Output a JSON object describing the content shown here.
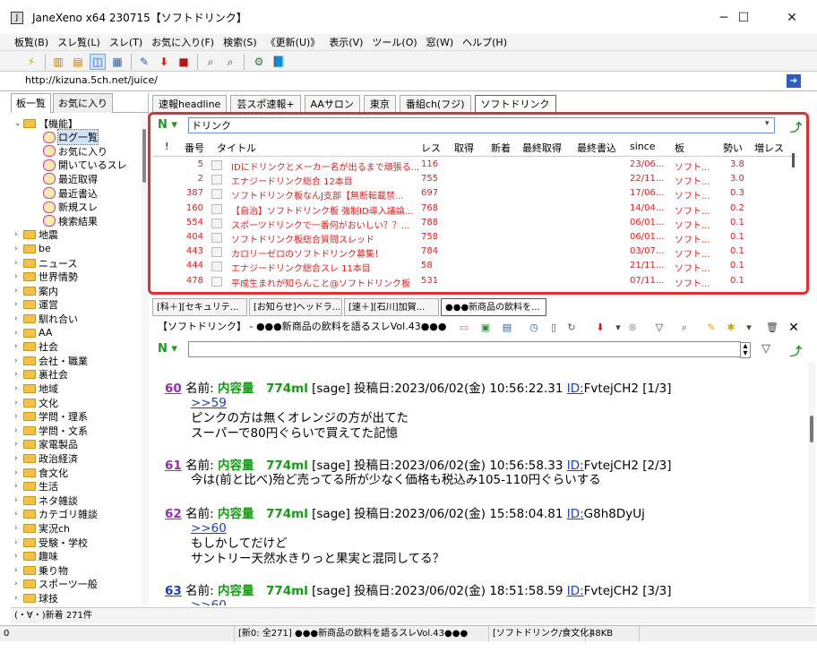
{
  "window": {
    "title": "JaneXeno x64 230715【ソフトドリンク】",
    "app_icon": "J",
    "minimize": "─",
    "maximize": "☐",
    "close": "✕"
  },
  "menu": [
    "板覧(B)",
    "スレ覧(L)",
    "スレ(T)",
    "お気に入り(F)",
    "検索(S)",
    "《更新(U)》",
    "表示(V)",
    "ツール(O)",
    "窓(W)",
    "ヘルプ(H)"
  ],
  "url": "http://kizuna.5ch.net/juice/",
  "left_tabs": [
    "板一覧",
    "お気に入り"
  ],
  "tree": [
    {
      "label": "【機能】",
      "type": "folder",
      "expanded": true,
      "indent": 0
    },
    {
      "label": "ログ一覧",
      "type": "item",
      "indent": 1,
      "selected": true
    },
    {
      "label": "お気に入り",
      "type": "item",
      "indent": 1
    },
    {
      "label": "開いているスレ",
      "type": "item",
      "indent": 1
    },
    {
      "label": "最近取得",
      "type": "item",
      "indent": 1
    },
    {
      "label": "最近書込",
      "type": "item",
      "indent": 1
    },
    {
      "label": "新規スレ",
      "type": "item",
      "indent": 1
    },
    {
      "label": "検索結果",
      "type": "item",
      "indent": 1
    },
    {
      "label": "地震",
      "type": "folder",
      "indent": 0
    },
    {
      "label": "be",
      "type": "folder",
      "indent": 0
    },
    {
      "label": "ニュース",
      "type": "folder",
      "indent": 0
    },
    {
      "label": "世界情勢",
      "type": "folder",
      "indent": 0
    },
    {
      "label": "案内",
      "type": "folder",
      "indent": 0
    },
    {
      "label": "運営",
      "type": "folder",
      "indent": 0
    },
    {
      "label": "馴れ合い",
      "type": "folder",
      "indent": 0
    },
    {
      "label": "AA",
      "type": "folder",
      "indent": 0
    },
    {
      "label": "社会",
      "type": "folder",
      "indent": 0
    },
    {
      "label": "会社・職業",
      "type": "folder",
      "indent": 0
    },
    {
      "label": "裏社会",
      "type": "folder",
      "indent": 0
    },
    {
      "label": "地域",
      "type": "folder",
      "indent": 0
    },
    {
      "label": "文化",
      "type": "folder",
      "indent": 0
    },
    {
      "label": "学問・理系",
      "type": "folder",
      "indent": 0
    },
    {
      "label": "学問・文系",
      "type": "folder",
      "indent": 0
    },
    {
      "label": "家電製品",
      "type": "folder",
      "indent": 0
    },
    {
      "label": "政治経済",
      "type": "folder",
      "indent": 0
    },
    {
      "label": "食文化",
      "type": "folder",
      "indent": 0
    },
    {
      "label": "生活",
      "type": "folder",
      "indent": 0
    },
    {
      "label": "ネタ雑談",
      "type": "folder",
      "indent": 0
    },
    {
      "label": "カテゴリ雑談",
      "type": "folder",
      "indent": 0
    },
    {
      "label": "実況ch",
      "type": "folder",
      "indent": 0
    },
    {
      "label": "受験・学校",
      "type": "folder",
      "indent": 0
    },
    {
      "label": "趣味",
      "type": "folder",
      "indent": 0
    },
    {
      "label": "乗り物",
      "type": "folder",
      "indent": 0
    },
    {
      "label": "スポーツ一般",
      "type": "folder",
      "indent": 0
    },
    {
      "label": "球技",
      "type": "folder",
      "indent": 0
    }
  ],
  "board_tabs": [
    "速報headline",
    "芸スポ速報+",
    "AAサロン",
    "東京",
    "番組ch(フジ)",
    "ソフトドリンク"
  ],
  "filter": {
    "value": "ドリンク"
  },
  "thread_columns": [
    "!",
    "番号",
    "タイトル",
    "レス",
    "取得",
    "新着",
    "最終取得",
    "最終書込",
    "since",
    "板",
    "勢い",
    "増レス"
  ],
  "threads": [
    {
      "no": "5",
      "title": "IDにドリンクとメーカー名が出るまで頑張る...",
      "res": "116",
      "since": "23/06...",
      "board": "ソフト...",
      "speed": "3.8"
    },
    {
      "no": "2",
      "title": "エナジードリンク総合 12本目",
      "res": "755",
      "since": "22/11...",
      "board": "ソフト...",
      "speed": "3.0"
    },
    {
      "no": "387",
      "title": "ソフトドリンク板なんJ支部【無断転載禁...",
      "res": "697",
      "since": "17/06...",
      "board": "ソフト...",
      "speed": "0.3"
    },
    {
      "no": "160",
      "title": "【自治】ソフトドリンク板 強制ID導入議論...",
      "res": "768",
      "since": "14/04...",
      "board": "ソフト...",
      "speed": "0.2"
    },
    {
      "no": "554",
      "title": "スポーツドリンクで一番何がおいしい？？...",
      "res": "788",
      "since": "06/01...",
      "board": "ソフト...",
      "speed": "0.1"
    },
    {
      "no": "404",
      "title": "ソフトドリンク板総合質問スレッド",
      "res": "758",
      "since": "06/01...",
      "board": "ソフト...",
      "speed": "0.1"
    },
    {
      "no": "443",
      "title": "カロリーゼロのソフトドリンク募集！",
      "res": "784",
      "since": "03/07...",
      "board": "ソフト...",
      "speed": "0.1"
    },
    {
      "no": "444",
      "title": "エナジードリンク総合スレ 11本目",
      "res": "58",
      "since": "21/11...",
      "board": "ソフト...",
      "speed": "0.1"
    },
    {
      "no": "478",
      "title": "平成生まれが知らんこと@ソフトドリンク板",
      "res": "531",
      "since": "07/11...",
      "board": "ソフト...",
      "speed": "0.1"
    }
  ],
  "thread_tabs": [
    "[科＋][セキュリテ...",
    "[お知らせ]ヘッドラ...",
    "[速＋][石川]加賀...",
    "●●●新商品の飲料を..."
  ],
  "thread_title": "【ソフトドリンク】 - ●●●新商品の飲料を語るスレVol.43●●●",
  "posts": [
    {
      "num": "60",
      "label": "名前:",
      "name": "内容量　774ml",
      "mail": "[sage]",
      "date": "投稿日:2023/06/02(金) 10:56:22.31",
      "id_label": "ID:",
      "id": "FvtejCH2",
      "seq": "[1/3]",
      "anchor": ">>59",
      "lines": [
        "ピンクの方は無くオレンジの方が出てた",
        "スーパーで80円ぐらいで買えてた記憶"
      ]
    },
    {
      "num": "61",
      "label": "名前:",
      "name": "内容量　774ml",
      "mail": "[sage]",
      "date": "投稿日:2023/06/02(金) 10:56:58.33",
      "id_label": "ID:",
      "id": "FvtejCH2",
      "seq": "[2/3]",
      "anchor": "",
      "lines": [
        "今は(前と比べ)殆ど売ってる所が少なく価格も税込み105-110円ぐらいする"
      ]
    },
    {
      "num": "62",
      "label": "名前:",
      "name": "内容量　774ml",
      "mail": "[sage]",
      "date": "投稿日:2023/06/02(金) 15:58:04.81",
      "id_label": "ID:",
      "id": "G8h8DyUj",
      "seq": "",
      "anchor": ">>60",
      "lines": [
        "もしかしてだけど",
        "サントリー天然水きりっと果実と混同してる？"
      ]
    },
    {
      "num": "63",
      "label": "名前:",
      "name": "内容量　774ml",
      "mail": "[sage]",
      "date": "投稿日:2023/06/02(金) 18:51:58.59",
      "id_label": "ID:",
      "id": "FvtejCH2",
      "seq": "[3/3]",
      "anchor": ">>60",
      "lines": []
    }
  ],
  "status1": "(・∀・)新着 271件",
  "status2": {
    "left": "0",
    "info": "[新0: 全271] ●●●新商品の飲料を語るスレVol.43●●●",
    "board": "[ソフトドリンク/食文化]",
    "size": "48KB"
  }
}
